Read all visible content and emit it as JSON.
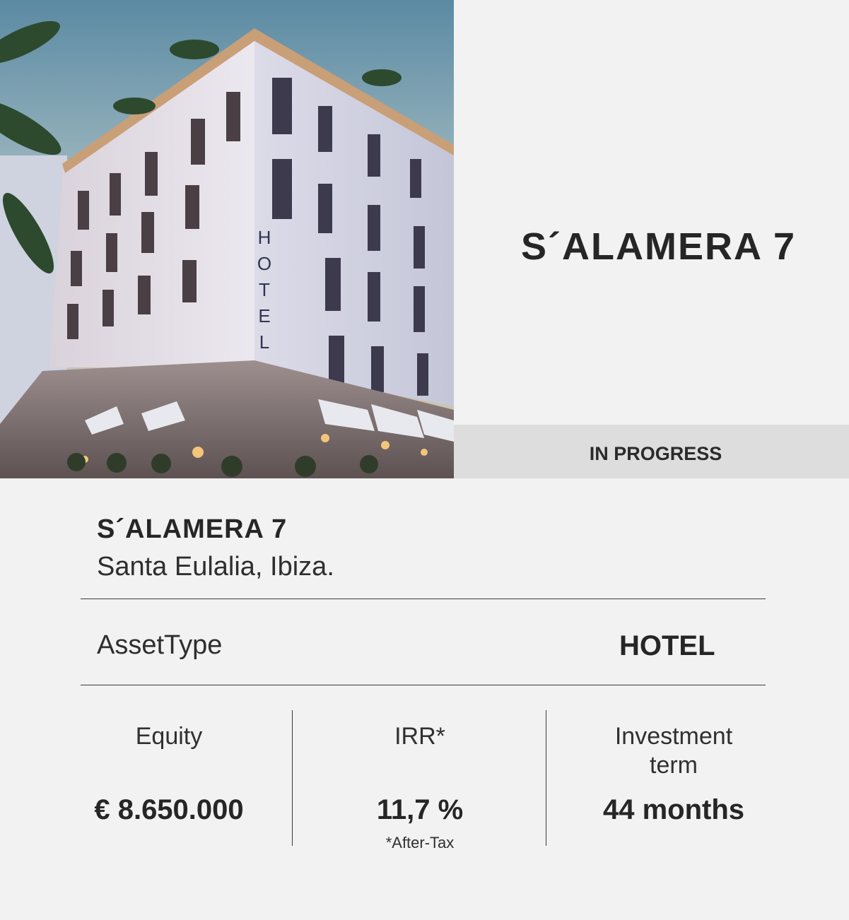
{
  "hero": {
    "image_alt": "Rendering of a white corner hotel building with balconies and a vertical HOTEL sign at dusk",
    "image_sign_text": "HOTEL",
    "title": "S´ALAMERA 7",
    "status": "IN PROGRESS"
  },
  "card": {
    "name": "S´ALAMERA 7",
    "location": "Santa Eulalia, Ibiza.",
    "asset_type_label": "AssetType",
    "asset_type_value": "HOTEL"
  },
  "metrics": [
    {
      "label": "Equity",
      "value": "€ 8.650.000"
    },
    {
      "label": "IRR*",
      "value": "11,7 %",
      "note": "*After-Tax"
    },
    {
      "label": "Investment term",
      "value": "44 months"
    }
  ],
  "colors": {
    "background": "#f3f2f2",
    "status_bar": "#dedddd",
    "text": "#262626",
    "rule": "#3a3a3a"
  }
}
